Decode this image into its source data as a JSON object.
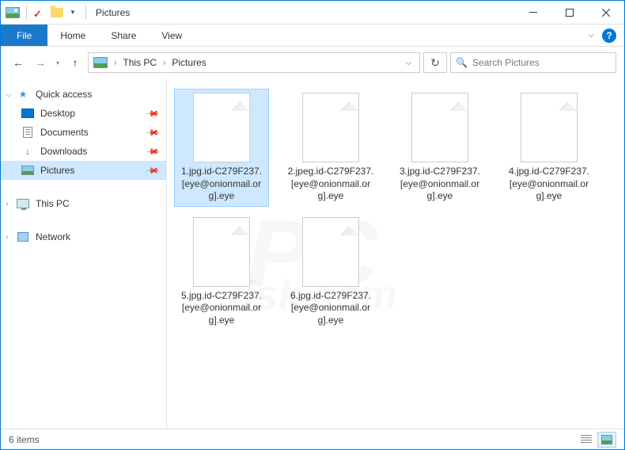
{
  "title": "Pictures",
  "ribbon": {
    "file": "File",
    "tabs": [
      "Home",
      "Share",
      "View"
    ]
  },
  "breadcrumb": {
    "items": [
      "This PC",
      "Pictures"
    ]
  },
  "search": {
    "placeholder": "Search Pictures"
  },
  "sidebar": {
    "quick_access": "Quick access",
    "items": [
      {
        "label": "Desktop",
        "icon": "desktop",
        "pinned": true
      },
      {
        "label": "Documents",
        "icon": "doc",
        "pinned": true
      },
      {
        "label": "Downloads",
        "icon": "dl",
        "pinned": true
      },
      {
        "label": "Pictures",
        "icon": "pic",
        "pinned": true,
        "selected": true
      }
    ],
    "this_pc": "This PC",
    "network": "Network"
  },
  "files": [
    {
      "name": "1.jpg.id-C279F237.[eye@onionmail.org].eye",
      "selected": true
    },
    {
      "name": "2.jpeg.id-C279F237.[eye@onionmail.org].eye",
      "selected": false
    },
    {
      "name": "3.jpg.id-C279F237.[eye@onionmail.org].eye",
      "selected": false
    },
    {
      "name": "4.jpg.id-C279F237.[eye@onionmail.org].eye",
      "selected": false
    },
    {
      "name": "5.jpg.id-C279F237.[eye@onionmail.org].eye",
      "selected": false
    },
    {
      "name": "6.jpg.id-C279F237.[eye@onionmail.org].eye",
      "selected": false
    }
  ],
  "status": {
    "count": "6 items"
  },
  "watermark": {
    "main": "PC",
    "sub": "risk.com"
  }
}
